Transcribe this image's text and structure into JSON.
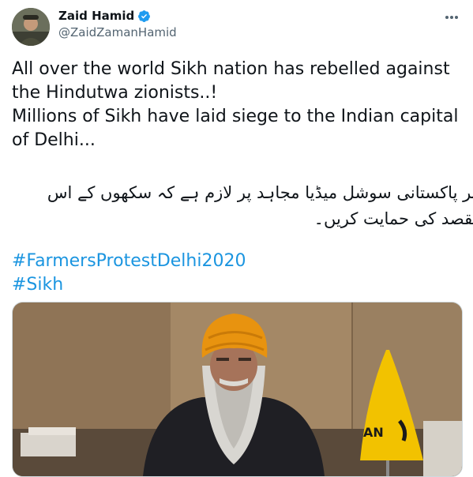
{
  "author": {
    "display_name": "Zaid Hamid",
    "handle": "@ZaidZamanHamid",
    "verified": true,
    "avatar_icon": "profile-photo"
  },
  "tweet": {
    "lines": [
      "All over the world Sikh nation has rebelled against the Hindutwa zionists..!",
      "Millions of Sikh have laid siege to the Indian capital of Delhi..."
    ],
    "urdu_text": "ہر پاکستانی سوشل میڈیا مجاہد پر لازم ہے کہ سکھوں کے اس مقصد کی حمایت کریں۔",
    "hashtags": [
      "#FarmersProtestDelhi2020",
      "#Sikh"
    ]
  },
  "media": {
    "flag_text": "AN"
  },
  "colors": {
    "link": "#1b95e0",
    "verified": "#1d9bf0",
    "turban": "#e8930f",
    "flag": "#f2c200"
  }
}
